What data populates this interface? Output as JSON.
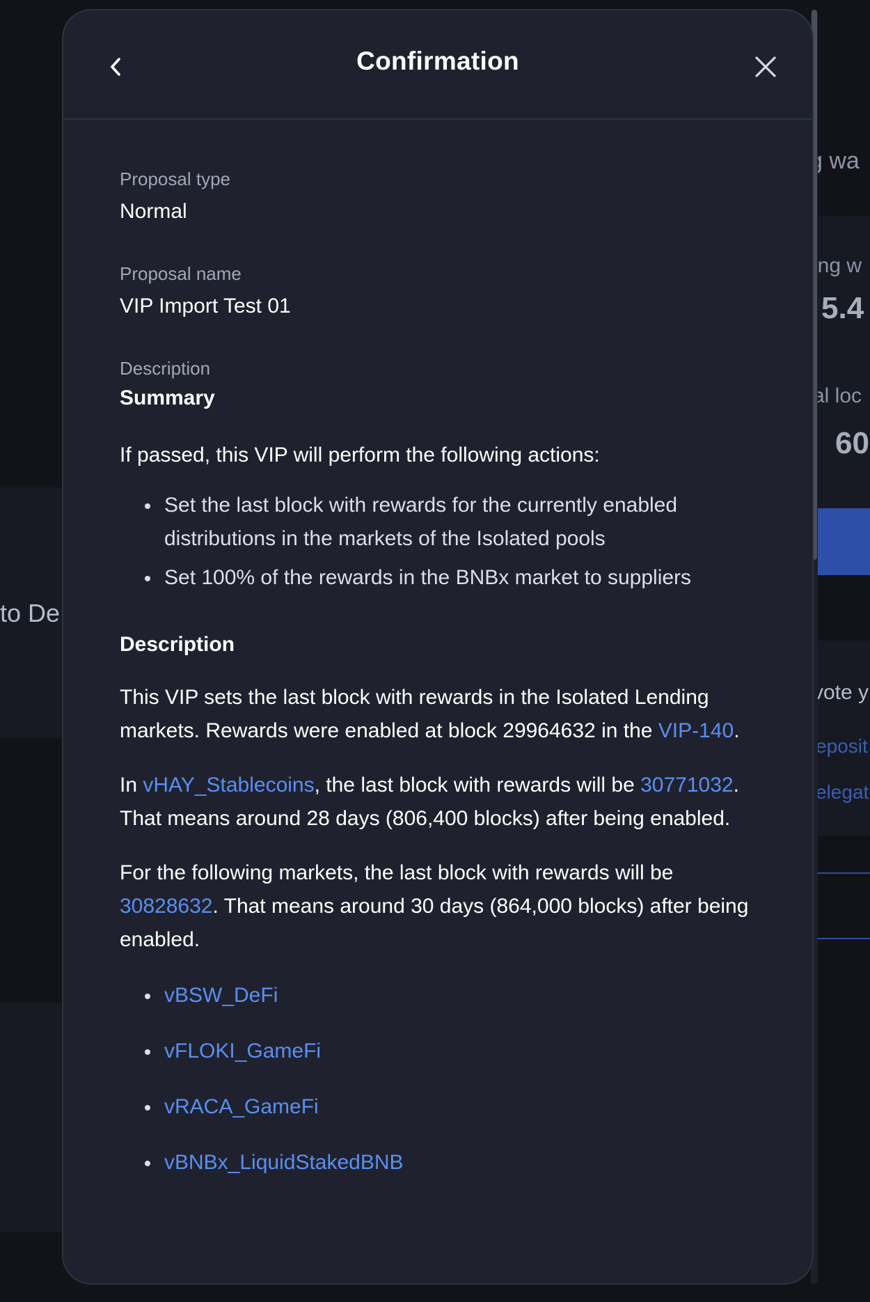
{
  "background": {
    "left_text": "to De",
    "right_texts": [
      "g wa",
      "ing w",
      "5.4",
      "al loc",
      "60",
      "vote y",
      "eposit",
      "elegat"
    ]
  },
  "modal": {
    "title": "Confirmation",
    "fields": {
      "proposal_type_label": "Proposal type",
      "proposal_type_value": "Normal",
      "proposal_name_label": "Proposal name",
      "proposal_name_value": "VIP Import Test 01",
      "description_label": "Description"
    },
    "description": {
      "summary_heading": "Summary",
      "intro": "If passed, this VIP will perform the following actions:",
      "actions": [
        "Set the last block with rewards for the currently enabled distributions in the markets of the Isolated pools",
        "Set 100% of the rewards in the BNBx market to suppliers"
      ],
      "description_heading": "Description",
      "p1_text": "This VIP sets the last block with rewards in the Isolated Lending markets. Rewards were enabled at block 29964632 in the ",
      "p1_link": "VIP-140",
      "p1_end": ".",
      "p2_start": "In ",
      "p2_link1": "vHAY_Stablecoins",
      "p2_mid": ", the last block with rewards will be ",
      "p2_link2": "30771032",
      "p2_end": ". That means around 28 days (806,400 blocks) after being enabled.",
      "p3_text": "For the following markets, the last block with rewards will be ",
      "p3_link": "30828632",
      "p3_end": ". That means around 30 days (864,000 blocks) after being enabled.",
      "markets": [
        "vBSW_DeFi",
        "vFLOKI_GameFi",
        "vRACA_GameFi",
        "vBNBx_LiquidStakedBNB"
      ]
    }
  },
  "colors": {
    "modal_bg": "#1f222e",
    "link": "#5b8ef2",
    "label": "#a1a7b6",
    "backdrop": "#111318"
  }
}
